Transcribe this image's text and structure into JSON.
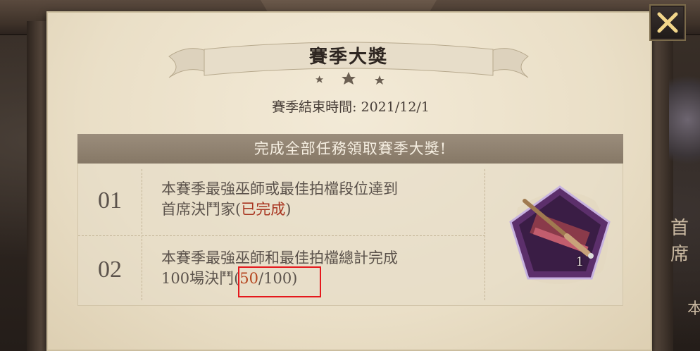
{
  "header": {
    "title": "賽季大獎",
    "end_time": "賽季結束時間: 2021/12/1"
  },
  "tasks_panel": {
    "header": "完成全部任務領取賽季大獎!",
    "tasks": [
      {
        "num": "01",
        "line1": "本賽季最強巫師或最佳拍檔段位達到",
        "line2_prefix": "首席決鬥家(",
        "status": "已完成",
        "line2_suffix": ")"
      },
      {
        "num": "02",
        "line1": "本賽季最強巫師和最佳拍檔總計完成",
        "line2_prefix": "100場決鬥(",
        "progress_current": "50",
        "progress_total": "/100)"
      }
    ]
  },
  "reward": {
    "icon": "wand-icon",
    "count": "1"
  },
  "side_text": {
    "top": "首席",
    "bottom": "本"
  },
  "colors": {
    "accent_done": "#a8341f",
    "accent_progress": "#b5451e",
    "highlight_box": "#e5181c"
  }
}
